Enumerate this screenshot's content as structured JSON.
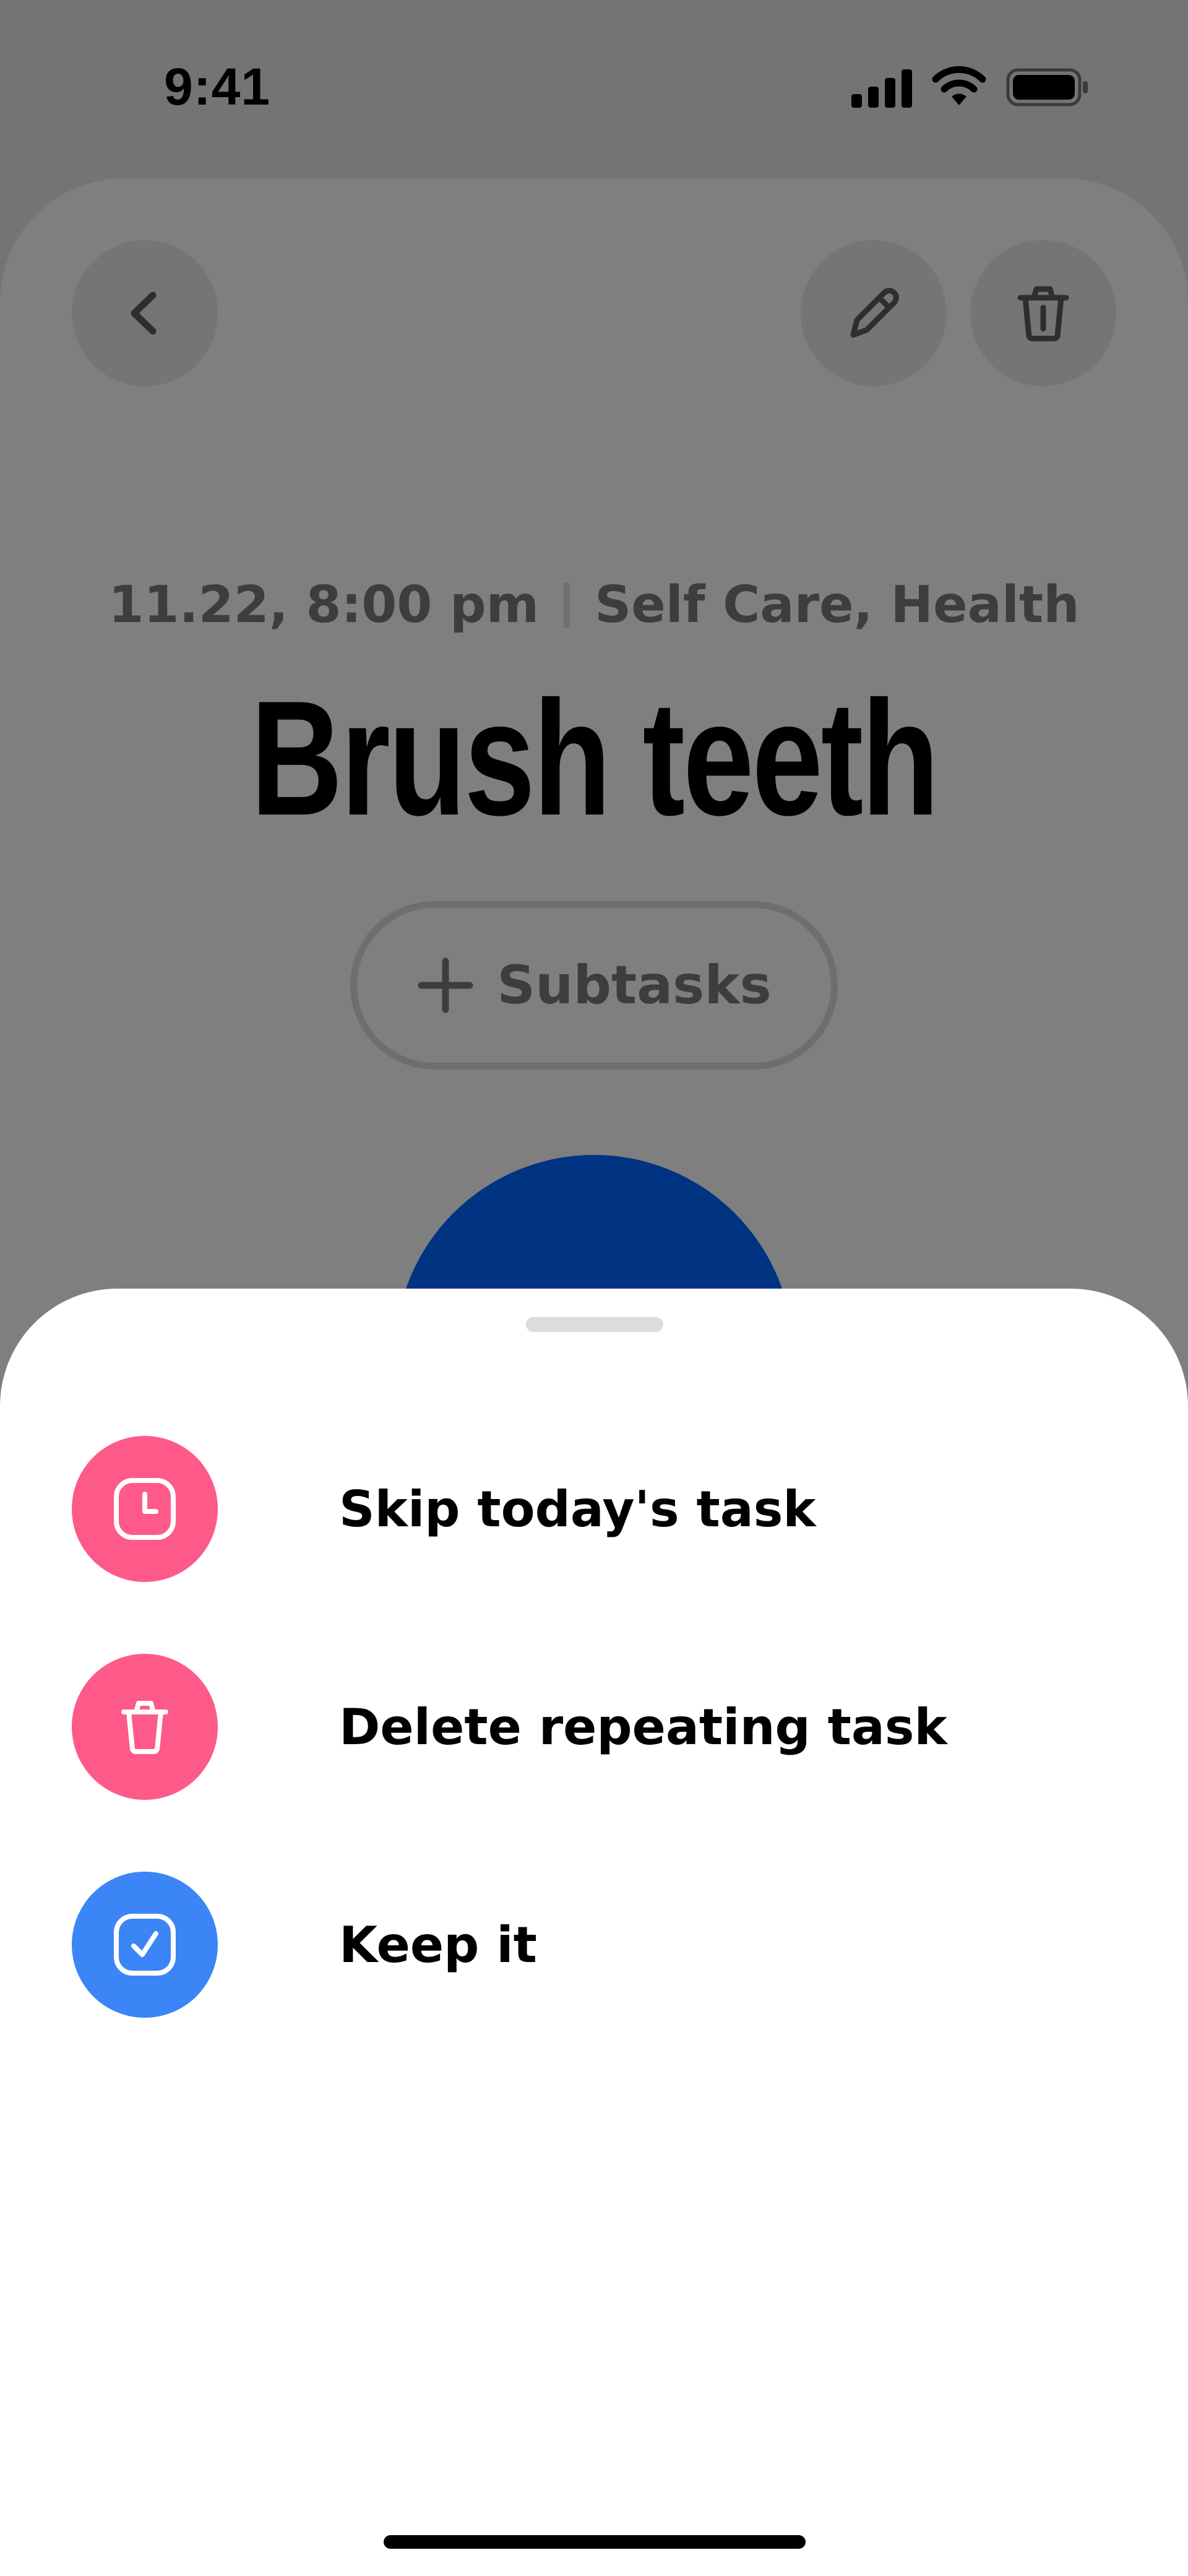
{
  "status_bar": {
    "time": "9:41",
    "icons": [
      "signal-icon",
      "wifi-icon",
      "battery-icon"
    ]
  },
  "task": {
    "date_time": "11.22, 8:00 pm",
    "categories": "Self Care, Health",
    "title": "Brush teeth",
    "subtasks_label": "Subtasks",
    "header_icons": [
      "back-icon",
      "pencil-icon",
      "trash-icon"
    ]
  },
  "sheet": {
    "options": [
      {
        "label": "Skip today's task",
        "icon": "clock-icon",
        "color": "#fe5a89"
      },
      {
        "label": "Delete repeating task",
        "icon": "trash-icon",
        "color": "#fe5a89"
      },
      {
        "label": "Keep it",
        "icon": "check-square-icon",
        "color": "#3b85f6"
      }
    ]
  },
  "colors": {
    "overlay_background": "#747474",
    "card_background": "#7f7f7f",
    "accent_blue_dark": "#003381",
    "sheet_background": "#ffffff"
  }
}
